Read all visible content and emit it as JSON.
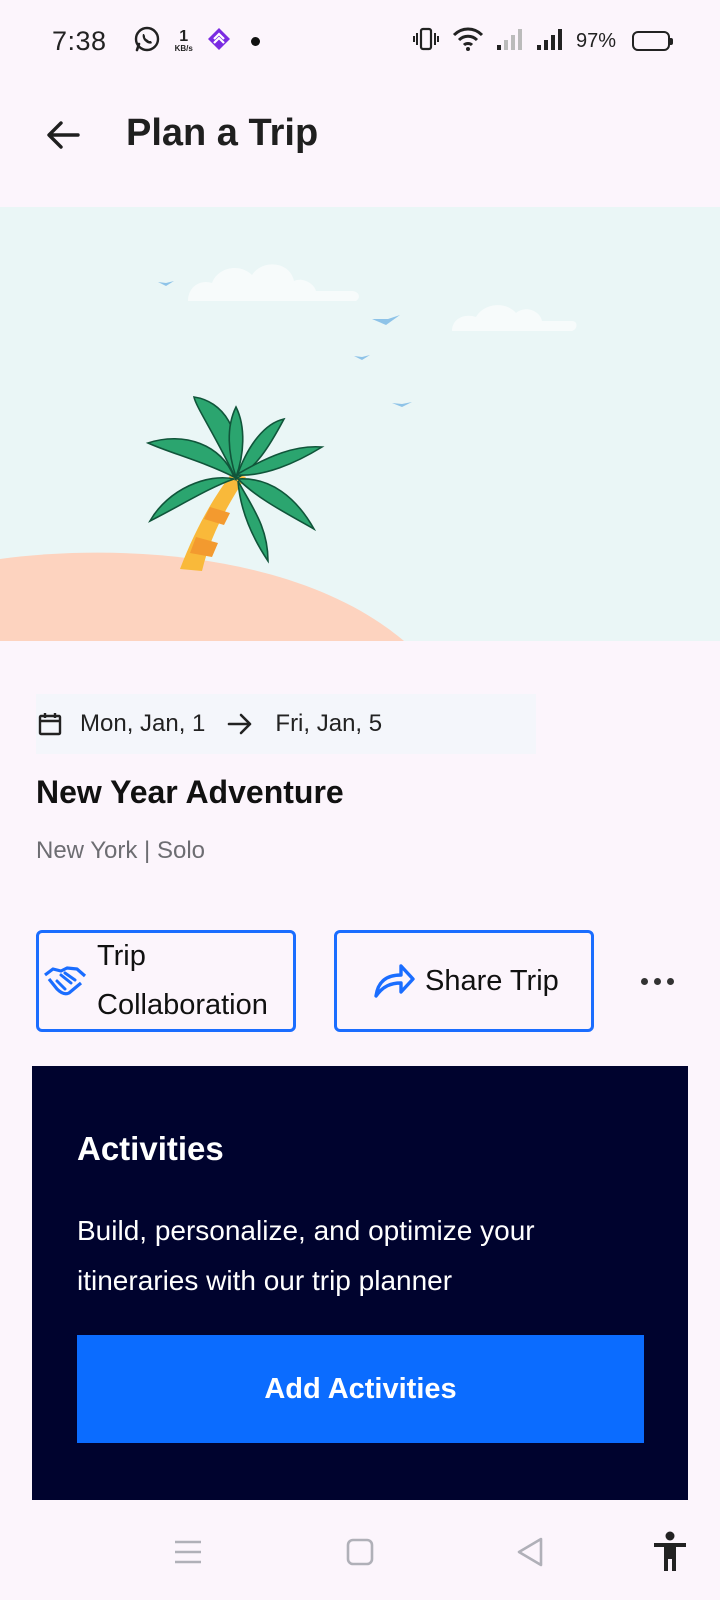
{
  "status_bar": {
    "time": "7:38",
    "net_speed_value": "1",
    "net_speed_unit": "KB/s",
    "battery_percent": "97%",
    "battery_color": "#f4c21f"
  },
  "header": {
    "title": "Plan a Trip",
    "back_icon": "arrow-left-icon"
  },
  "hero": {
    "sky_color": "#eaf6f6",
    "sand_color": "#fdd3bf",
    "illustration": "palm-tree-beach"
  },
  "trip": {
    "start_date": "Mon, Jan, 1",
    "end_date": "Fri, Jan, 5",
    "title": "New Year Adventure",
    "meta": "New York | Solo"
  },
  "actions": {
    "collaboration_label_line1": "Trip",
    "collaboration_label_line2": "Collaboration",
    "share_label": "Share Trip",
    "accent_color": "#1a6dff"
  },
  "activities": {
    "title": "Activities",
    "description": "Build, personalize, and optimize your itineraries with our trip planner",
    "button_label": "Add Activities",
    "card_color": "#00032e",
    "button_color": "#0b6cff"
  },
  "nav_bar": {
    "items": [
      "menu-icon",
      "home-square-icon",
      "back-triangle-icon",
      "accessibility-icon"
    ]
  }
}
